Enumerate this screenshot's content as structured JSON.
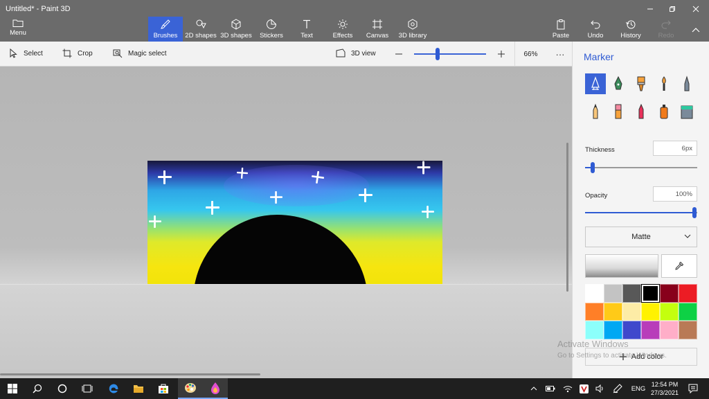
{
  "window": {
    "title": "Untitled* - Paint 3D"
  },
  "ribbon": {
    "menu_label": "Menu",
    "tools": [
      {
        "label": "Brushes",
        "icon": "brush-icon",
        "active": true
      },
      {
        "label": "2D shapes",
        "icon": "2d-shapes-icon"
      },
      {
        "label": "3D shapes",
        "icon": "3d-shapes-icon"
      },
      {
        "label": "Stickers",
        "icon": "stickers-icon"
      },
      {
        "label": "Text",
        "icon": "text-icon"
      },
      {
        "label": "Effects",
        "icon": "effects-icon"
      },
      {
        "label": "Canvas",
        "icon": "canvas-icon"
      },
      {
        "label": "3D library",
        "icon": "3d-library-icon"
      }
    ],
    "actions": [
      {
        "label": "Paste",
        "icon": "paste-icon"
      },
      {
        "label": "Undo",
        "icon": "undo-icon"
      },
      {
        "label": "History",
        "icon": "history-icon"
      },
      {
        "label": "Redo",
        "icon": "redo-icon",
        "disabled": true
      }
    ]
  },
  "toolbar": {
    "select_label": "Select",
    "crop_label": "Crop",
    "magic_select_label": "Magic select",
    "view_3d_label": "3D view",
    "zoom_value": "66%",
    "zoom_level": 0.33,
    "more_label": "···"
  },
  "panel": {
    "title": "Marker",
    "brushes": [
      {
        "name": "marker-brush-icon",
        "selected": true
      },
      {
        "name": "calligraphy-pen-brush-icon"
      },
      {
        "name": "oil-brush-icon"
      },
      {
        "name": "watercolor-brush-icon"
      },
      {
        "name": "pixel-pen-brush-icon"
      },
      {
        "name": "pencil-brush-icon"
      },
      {
        "name": "eraser-brush-icon"
      },
      {
        "name": "crayon-brush-icon"
      },
      {
        "name": "spray-can-brush-icon"
      },
      {
        "name": "fill-bucket-brush-icon"
      }
    ],
    "thickness_label": "Thickness",
    "thickness_value": "6px",
    "thickness_level": 0.07,
    "opacity_label": "Opacity",
    "opacity_value": "100%",
    "opacity_level": 1.0,
    "finish_value": "Matte",
    "palette": [
      "#ffffff",
      "#c3c3c3",
      "#585858",
      "#000000",
      "#88001b",
      "#ec1c24",
      "#ff7f27",
      "#ffca18",
      "#fdeca6",
      "#fff200",
      "#c4ff0e",
      "#0ed145",
      "#8cfffb",
      "#00a8f3",
      "#3f48cc",
      "#b83dba",
      "#ffaec8",
      "#b97a56"
    ],
    "selected_color": "#000000",
    "add_color_label": "Add color"
  },
  "watermark": {
    "title": "Activate Windows",
    "subtitle": "Go to Settings to activate Windows."
  },
  "taskbar": {
    "items": [
      "windows-start-icon",
      "search-icon",
      "cortana-icon",
      "task-view-icon",
      "edge-icon",
      "file-explorer-icon",
      "store-icon",
      "paint-palette-icon",
      "paint-3d-icon"
    ],
    "language": "ENG",
    "time": "12:54 PM",
    "date": "27/3/2021"
  },
  "colors": {
    "accent": "#3a63d6",
    "ribbon_bg": "#6b6b6b",
    "panel_bg": "#f4f4f4",
    "taskbar_bg": "#1f1f1f"
  }
}
